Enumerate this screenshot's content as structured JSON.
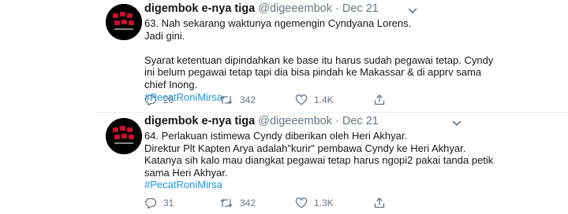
{
  "tweets": [
    {
      "display_name": "digembok e-nya tiga",
      "handle": "@digeeembok",
      "separator": "·",
      "date": "Dec 21",
      "lines": [
        "63. Nah sekarang waktunya ngemengin Cyndyana Lorens.",
        "Jadi gini.",
        "",
        "Syarat ketentuan dipindahkan ke base itu harus sudah pegawai tetap. Cyndy",
        "ini belum pegawai tetap tapi dia bisa pindah ke Makassar & di apprv sama",
        "chief Inong."
      ],
      "hashtag": "#PecatRoniMirsa",
      "replies": "28",
      "retweets": "342",
      "likes": "1.4K"
    },
    {
      "display_name": "digembok e-nya tiga",
      "handle": "@digeeembok",
      "separator": "·",
      "date": "Dec 21",
      "lines": [
        "64. Perlakuan istimewa Cyndy diberikan oleh Heri Akhyar.",
        "Direktur Plt Kapten Arya adalah\"kurir\" pembawa Cyndy ke Heri Akhyar.",
        "Katanya sih kalo mau diangkat pegawai tetap harus ngopi2 pakai tanda petik",
        "sama Heri Akhyar."
      ],
      "hashtag": "#PecatRoniMirsa",
      "replies": "31",
      "retweets": "342",
      "likes": "1.3K"
    }
  ],
  "colors": {
    "text_primary": "#14171a",
    "text_secondary": "#657786",
    "hashtag": "#1b95e0",
    "divider": "#e6ecf0",
    "avatar_bg": "#000000",
    "avatar_mark": "#c8102e"
  },
  "icons": [
    "avatar-logo",
    "chevron-down-icon",
    "reply-icon",
    "retweet-icon",
    "like-icon",
    "share-icon"
  ]
}
